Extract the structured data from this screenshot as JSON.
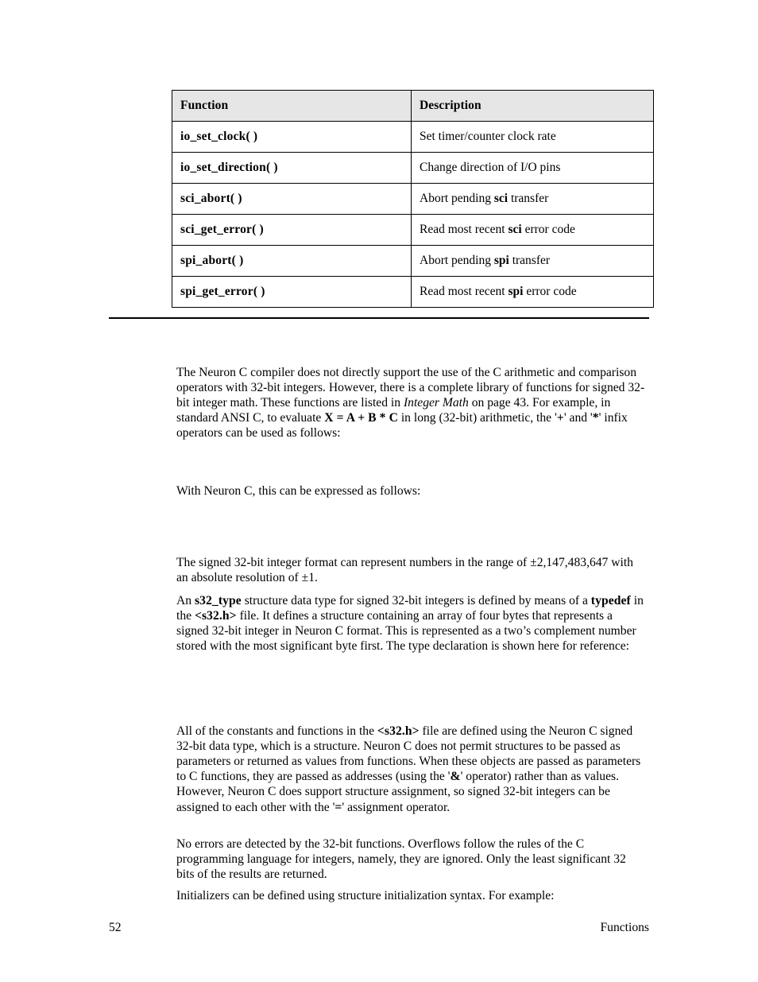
{
  "page": {
    "background_color": "#ffffff",
    "text_color": "#000000"
  },
  "table": {
    "header_background": "#e6e6e6",
    "border_color": "#000000",
    "columns": [
      "Function",
      "Description"
    ],
    "rows": [
      {
        "function": "io_set_clock( )",
        "desc_pre": "Set timer/counter clock rate",
        "desc_bold": "",
        "desc_post": ""
      },
      {
        "function": "io_set_direction( )",
        "desc_pre": "Change direction of I/O pins",
        "desc_bold": "",
        "desc_post": ""
      },
      {
        "function": "sci_abort( )",
        "desc_pre": "Abort pending ",
        "desc_bold": "sci",
        "desc_post": " transfer"
      },
      {
        "function": "sci_get_error( )",
        "desc_pre": "Read most recent ",
        "desc_bold": "sci",
        "desc_post": " error code"
      },
      {
        "function": "spi_abort( )",
        "desc_pre": "Abort pending ",
        "desc_bold": "spi",
        "desc_post": " transfer"
      },
      {
        "function": "spi_get_error( )",
        "desc_pre": "Read most recent ",
        "desc_bold": "spi",
        "desc_post": " error code"
      }
    ]
  },
  "paragraphs": {
    "p1": {
      "s1": "The Neuron C compiler does not directly support the use of the C arithmetic and comparison operators with 32-bit integers.  However, there is a complete library of functions for signed 32-bit integer math.  These functions are listed in ",
      "italic1": "Integer Math",
      "s2": " on page 43.  For example, in standard ANSI C, to evaluate ",
      "bold1": "X = A + B * C",
      "s3": " in long (32-bit) arithmetic, the '",
      "bold2": "+",
      "s4": "' and '",
      "bold3": "*",
      "s5": "' infix operators can be used as follows:"
    },
    "p2": {
      "s1": "With Neuron C, this can be expressed as follows:"
    },
    "p3": {
      "s1": "The signed 32-bit integer format can represent numbers in the range of ±2,147,483,647 with an absolute resolution of ±1."
    },
    "p4": {
      "s1": "An ",
      "bold1": "s32_type",
      "s2": " structure data type for signed 32-bit integers is defined by means of a ",
      "bold2": "typedef",
      "s3": " in the ",
      "bold3": "<s32.h>",
      "s4": " file.  It defines a structure containing an array of four bytes that represents a signed 32-bit integer in Neuron C format.  This is represented as a two’s complement number stored with the most significant byte first.  The type declaration is shown here for reference:"
    },
    "p5": {
      "s1": "All of the constants and functions in the ",
      "bold1": "<s32.h>",
      "s2": " file are defined using the Neuron C signed 32-bit data type, which is a structure.  Neuron C does not permit structures to be passed as parameters or returned as values from functions.  When these objects are passed as parameters to C functions, they are passed as addresses (using the '",
      "bold2": "&",
      "s3": "' operator) rather than as values.  However, Neuron C does support structure assignment, so signed 32-bit integers can be assigned to each other with the '",
      "bold3": "=",
      "s4": "' assignment operator."
    },
    "p6": {
      "s1": "No errors are detected by the 32-bit functions.  Overflows follow the rules of the C programming language for integers, namely, they are ignored.  Only the least significant 32 bits of the results are returned."
    },
    "p7": {
      "s1": "Initializers can be defined using structure initialization syntax.  For example:"
    }
  },
  "footer": {
    "page_number": "52",
    "chapter": "Functions"
  }
}
